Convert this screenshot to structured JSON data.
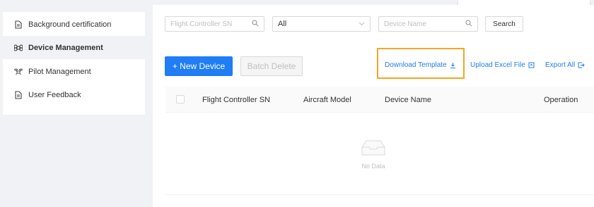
{
  "sidebar": {
    "items": [
      {
        "label": "Background certification",
        "icon": "document-icon"
      },
      {
        "label": "Device Management",
        "icon": "command-icon"
      },
      {
        "label": "Pilot Management",
        "icon": "drone-icon"
      },
      {
        "label": "User Feedback",
        "icon": "document-icon"
      }
    ],
    "active_index": 1
  },
  "filters": {
    "sn_placeholder": "Flight Controller SN",
    "type_select_value": "All",
    "device_name_placeholder": "Device Name",
    "search_label": "Search"
  },
  "toolbar": {
    "new_device_label": "+ New Device",
    "batch_delete_label": "Batch Delete",
    "download_template_label": "Download Template",
    "upload_excel_label": "Upload Excel File",
    "export_all_label": "Export All"
  },
  "table": {
    "columns": [
      "Flight Controller SN",
      "Aircraft Model",
      "Device Name",
      "Operation"
    ],
    "rows": [],
    "empty_text": "No Data"
  },
  "colors": {
    "accent": "#1f7df5",
    "highlight": "#f5a623",
    "background": "#f0f2f5"
  }
}
